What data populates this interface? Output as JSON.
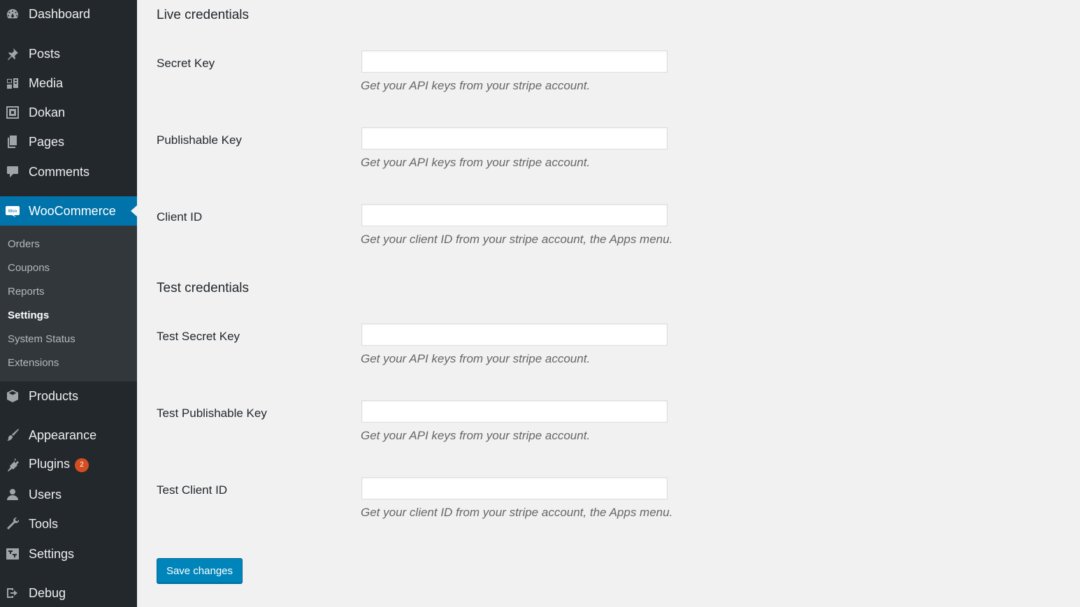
{
  "sidebar": {
    "items": [
      {
        "label": "Dashboard",
        "icon": "dashboard-icon"
      },
      {
        "label": "Posts",
        "icon": "pin-icon"
      },
      {
        "label": "Media",
        "icon": "media-icon"
      },
      {
        "label": "Dokan",
        "icon": "dokan-icon"
      },
      {
        "label": "Pages",
        "icon": "pages-icon"
      },
      {
        "label": "Comments",
        "icon": "comment-icon"
      },
      {
        "label": "WooCommerce",
        "icon": "woocommerce-icon",
        "active": true
      },
      {
        "label": "Products",
        "icon": "products-icon"
      },
      {
        "label": "Appearance",
        "icon": "brush-icon"
      },
      {
        "label": "Plugins",
        "icon": "plugin-icon",
        "badge": "2"
      },
      {
        "label": "Users",
        "icon": "user-icon"
      },
      {
        "label": "Tools",
        "icon": "wrench-icon"
      },
      {
        "label": "Settings",
        "icon": "settings-icon"
      },
      {
        "label": "Debug",
        "icon": "exit-icon"
      }
    ],
    "submenu": [
      {
        "label": "Orders"
      },
      {
        "label": "Coupons"
      },
      {
        "label": "Reports"
      },
      {
        "label": "Settings",
        "current": true
      },
      {
        "label": "System Status"
      },
      {
        "label": "Extensions"
      }
    ],
    "active_color": "#0073aa",
    "background_color": "#23282d",
    "badge_color": "#d54e21"
  },
  "main": {
    "live_title": "Live credentials",
    "test_title": "Test credentials",
    "fields": [
      {
        "label": "Secret Key",
        "value": "",
        "description": "Get your API keys from your stripe account."
      },
      {
        "label": "Publishable Key",
        "value": "",
        "description": "Get your API keys from your stripe account."
      },
      {
        "label": "Client ID",
        "value": "",
        "description": "Get your client ID from your stripe account, the Apps menu."
      },
      {
        "label": "Test Secret Key",
        "value": "",
        "description": "Get your API keys from your stripe account."
      },
      {
        "label": "Test Publishable Key",
        "value": "",
        "description": "Get your API keys from your stripe account."
      },
      {
        "label": "Test Client ID",
        "value": "",
        "description": "Get your client ID from your stripe account, the Apps menu."
      }
    ],
    "save_label": "Save changes",
    "button_color": "#0085ba"
  }
}
